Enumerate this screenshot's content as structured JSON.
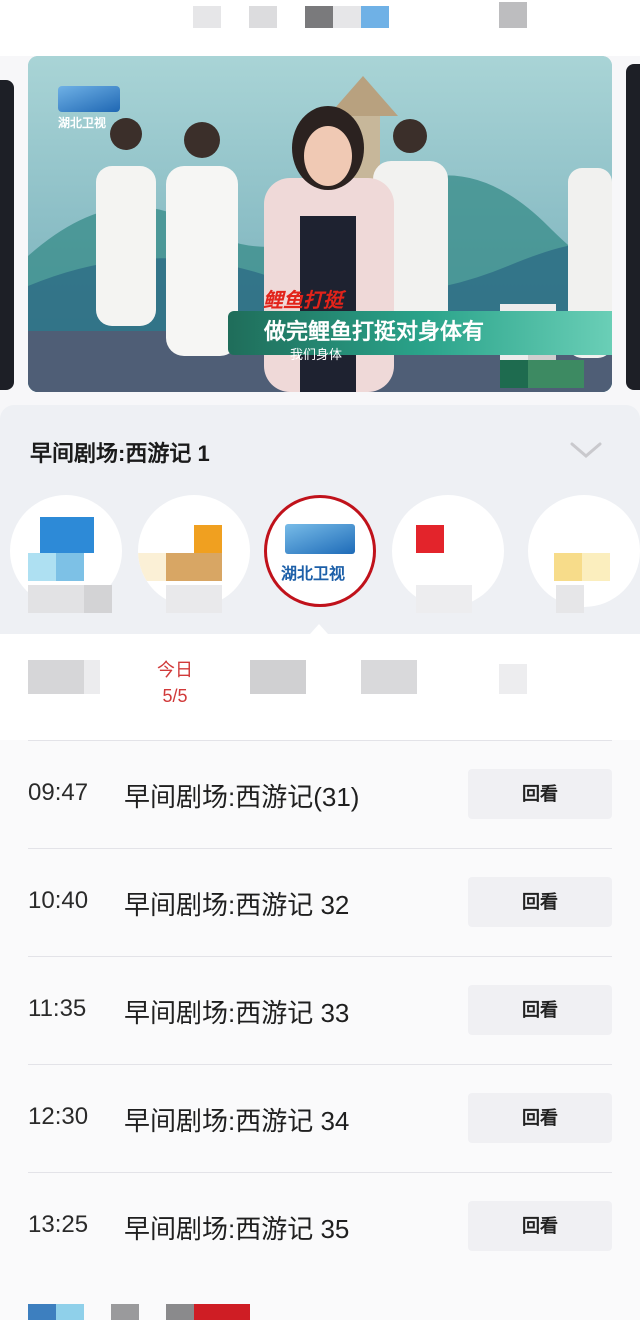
{
  "player": {
    "channel_logo_text": "湖北卫视",
    "overlay_title": "鲤鱼打挺",
    "overlay_caption": "做完鲤鱼打挺对身体有",
    "subtitle": "我们身体"
  },
  "program": {
    "current_title": "早间剧场:西游记 1"
  },
  "channels": {
    "selected_name": "湖北卫视"
  },
  "dates": {
    "today_label": "今日",
    "today_date": "5/5"
  },
  "schedule": [
    {
      "time": "09:47",
      "title": "早间剧场:西游记(31)",
      "action": "回看"
    },
    {
      "time": "10:40",
      "title": "早间剧场:西游记 32",
      "action": "回看"
    },
    {
      "time": "11:35",
      "title": "早间剧场:西游记 33",
      "action": "回看"
    },
    {
      "time": "12:30",
      "title": "早间剧场:西游记 34",
      "action": "回看"
    },
    {
      "time": "13:25",
      "title": "早间剧场:西游记 35",
      "action": "回看"
    }
  ],
  "colors": {
    "accent_red": "#c0121b",
    "brand_blue": "#1e6bb8"
  }
}
